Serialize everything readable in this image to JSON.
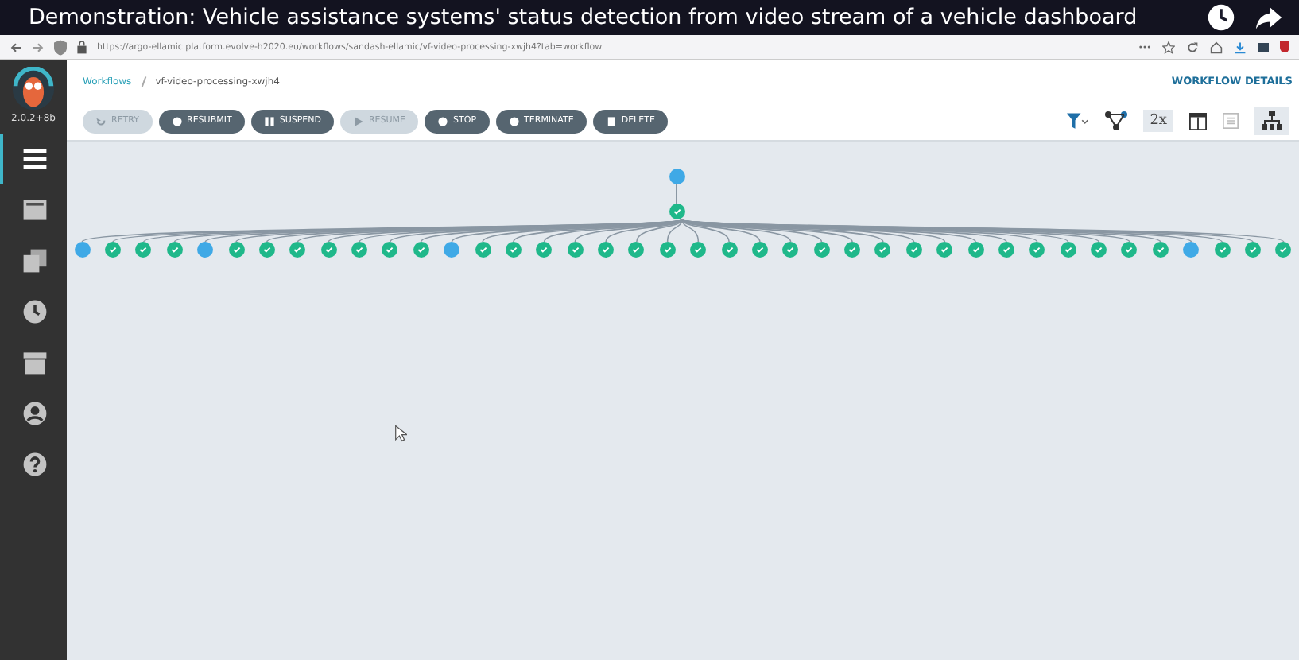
{
  "video_title": "Demonstration: Vehicle assistance systems' status detection from video stream of a vehicle dashboard",
  "browser": {
    "url": "https://argo-ellamic.platform.evolve-h2020.eu/workflows/sandash-ellamic/vf-video-processing-xwjh4?tab=workflow"
  },
  "sidebar": {
    "version": "2.0.2+8b",
    "items": [
      {
        "kind": "workflows",
        "selected": true
      },
      {
        "kind": "templates",
        "selected": false
      },
      {
        "kind": "cluster",
        "selected": false
      },
      {
        "kind": "cron",
        "selected": false
      },
      {
        "kind": "archive",
        "selected": false
      },
      {
        "kind": "user",
        "selected": false
      },
      {
        "kind": "help",
        "selected": false
      }
    ]
  },
  "breadcrumb": [
    "Workflows",
    "vf-video-processing-xwjh4"
  ],
  "details_link": "WORKFLOW DETAILS",
  "actions": [
    {
      "label": "RETRY",
      "kind": "retry",
      "disabled": true
    },
    {
      "label": "RESUBMIT",
      "kind": "circle",
      "disabled": false
    },
    {
      "label": "SUSPEND",
      "kind": "pause",
      "disabled": false
    },
    {
      "label": "RESUME",
      "kind": "play",
      "disabled": true
    },
    {
      "label": "STOP",
      "kind": "circle",
      "disabled": false
    },
    {
      "label": "TERMINATE",
      "kind": "circle",
      "disabled": false
    },
    {
      "label": "DELETE",
      "kind": "trash",
      "disabled": false
    }
  ],
  "zoom_label": "2x",
  "graph": {
    "root": [
      {
        "kind": "running"
      },
      {
        "kind": "succeeded"
      }
    ],
    "children": [
      {
        "kind": "running"
      },
      {
        "kind": "succeeded"
      },
      {
        "kind": "succeeded"
      },
      {
        "kind": "succeeded"
      },
      {
        "kind": "running"
      },
      {
        "kind": "succeeded"
      },
      {
        "kind": "succeeded"
      },
      {
        "kind": "succeeded"
      },
      {
        "kind": "succeeded"
      },
      {
        "kind": "succeeded"
      },
      {
        "kind": "succeeded"
      },
      {
        "kind": "succeeded"
      },
      {
        "kind": "running"
      },
      {
        "kind": "succeeded"
      },
      {
        "kind": "succeeded"
      },
      {
        "kind": "succeeded"
      },
      {
        "kind": "succeeded"
      },
      {
        "kind": "succeeded"
      },
      {
        "kind": "succeeded"
      },
      {
        "kind": "succeeded"
      },
      {
        "kind": "succeeded"
      },
      {
        "kind": "succeeded"
      },
      {
        "kind": "succeeded"
      },
      {
        "kind": "succeeded"
      },
      {
        "kind": "succeeded"
      },
      {
        "kind": "succeeded"
      },
      {
        "kind": "succeeded"
      },
      {
        "kind": "succeeded"
      },
      {
        "kind": "succeeded"
      },
      {
        "kind": "succeeded"
      },
      {
        "kind": "succeeded"
      },
      {
        "kind": "succeeded"
      },
      {
        "kind": "succeeded"
      },
      {
        "kind": "succeeded"
      },
      {
        "kind": "succeeded"
      },
      {
        "kind": "succeeded"
      },
      {
        "kind": "running"
      },
      {
        "kind": "succeeded"
      },
      {
        "kind": "succeeded"
      },
      {
        "kind": "succeeded"
      }
    ]
  }
}
